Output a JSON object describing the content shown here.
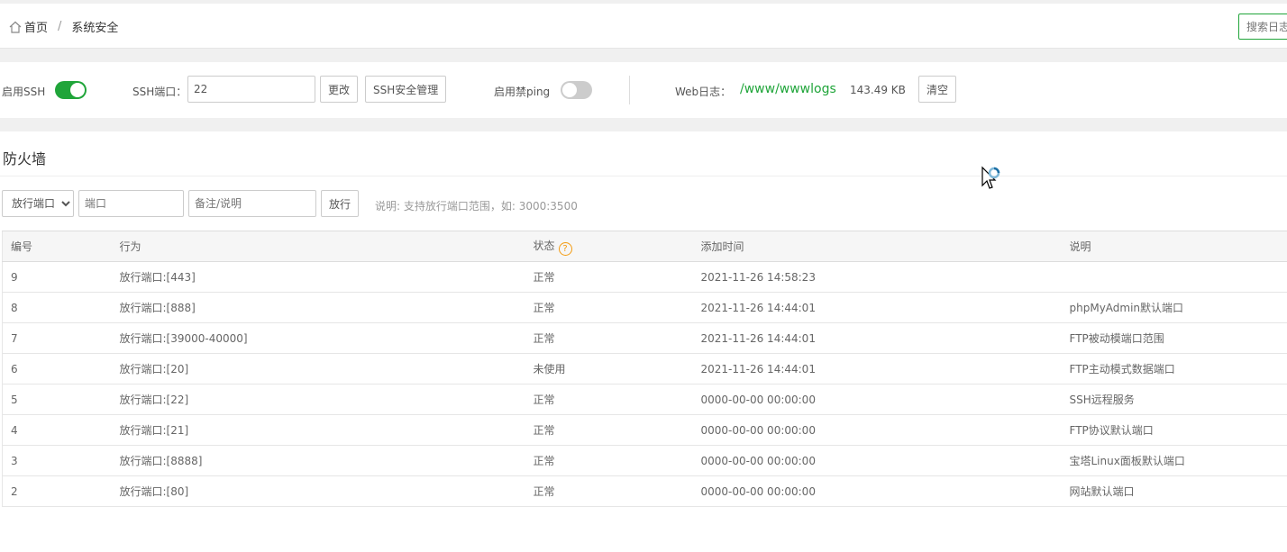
{
  "breadcrumb": {
    "home": "首页",
    "separator": "/",
    "current": "系统安全"
  },
  "header": {
    "log_search_placeholder": "搜索日志"
  },
  "ssh": {
    "enable_label": "启用SSH",
    "enabled": true,
    "port_label": "SSH端口：",
    "port_value": "22",
    "change_button": "更改",
    "manage_button": "SSH安全管理",
    "ping_label": "启用禁ping",
    "ping_enabled": false,
    "weblog_label": "Web日志：",
    "weblog_path": "/www/wwwlogs",
    "weblog_size": "143.49 KB",
    "clear_button": "清空"
  },
  "firewall": {
    "title": "防火墙",
    "type_select": "放行端口",
    "port_placeholder": "端口",
    "note_placeholder": "备注/说明",
    "allow_button": "放行",
    "hint": "说明: 支持放行端口范围，如: 3000:3500",
    "columns": {
      "id": "编号",
      "action": "行为",
      "status": "状态",
      "time": "添加时间",
      "note": "说明"
    },
    "rows": [
      {
        "id": "9",
        "action": "放行端口:[443]",
        "status": "正常",
        "time": "2021-11-26 14:58:23",
        "note": ""
      },
      {
        "id": "8",
        "action": "放行端口:[888]",
        "status": "正常",
        "time": "2021-11-26 14:44:01",
        "note": "phpMyAdmin默认端口"
      },
      {
        "id": "7",
        "action": "放行端口:[39000-40000]",
        "status": "正常",
        "time": "2021-11-26 14:44:01",
        "note": "FTP被动模端口范围"
      },
      {
        "id": "6",
        "action": "放行端口:[20]",
        "status": "未使用",
        "time": "2021-11-26 14:44:01",
        "note": "FTP主动模式数据端口"
      },
      {
        "id": "5",
        "action": "放行端口:[22]",
        "status": "正常",
        "time": "0000-00-00 00:00:00",
        "note": "SSH远程服务"
      },
      {
        "id": "4",
        "action": "放行端口:[21]",
        "status": "正常",
        "time": "0000-00-00 00:00:00",
        "note": "FTP协议默认端口"
      },
      {
        "id": "3",
        "action": "放行端口:[8888]",
        "status": "正常",
        "time": "0000-00-00 00:00:00",
        "note": "宝塔Linux面板默认端口"
      },
      {
        "id": "2",
        "action": "放行端口:[80]",
        "status": "正常",
        "time": "0000-00-00 00:00:00",
        "note": "网站默认端口"
      }
    ]
  },
  "colors": {
    "accent": "#20a53a",
    "help": "#f39c12"
  },
  "icons": {
    "home": "home-icon",
    "help": "question-circle-icon",
    "cursor": "busy-cursor-icon"
  }
}
